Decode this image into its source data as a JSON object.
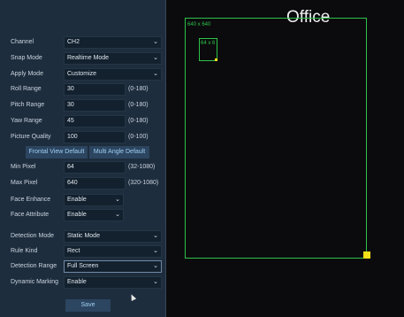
{
  "form": {
    "channel": {
      "label": "Channel",
      "value": "CH2"
    },
    "snap_mode": {
      "label": "Snap Mode",
      "value": "Realtime Mode"
    },
    "apply_mode": {
      "label": "Apply Mode",
      "value": "Customize"
    },
    "roll_range": {
      "label": "Roll Range",
      "value": "30",
      "hint": "(0-180)"
    },
    "pitch_range": {
      "label": "Pitch Range",
      "value": "30",
      "hint": "(0-180)"
    },
    "yaw_range": {
      "label": "Yaw Range",
      "value": "45",
      "hint": "(0-180)"
    },
    "picture_quality": {
      "label": "Picture Quality",
      "value": "100",
      "hint": "(0-100)"
    },
    "frontal_default_label": "Frontal View Default",
    "multi_angle_default_label": "Multi Angle Default",
    "min_pixel": {
      "label": "Min Pixel",
      "value": "64",
      "hint": "(32-1080)"
    },
    "max_pixel": {
      "label": "Max Pixel",
      "value": "640",
      "hint": "(320-1080)"
    },
    "face_enhance": {
      "label": "Face Enhance",
      "value": "Enable"
    },
    "face_attribute": {
      "label": "Face Attribute",
      "value": "Enable"
    },
    "detection_mode": {
      "label": "Detection Mode",
      "value": "Static Mode"
    },
    "rule_kind": {
      "label": "Rule Kind",
      "value": "Rect"
    },
    "detection_range": {
      "label": "Detection Range",
      "value": "Full Screen"
    },
    "dynamic_marking": {
      "label": "Dynamic Marking",
      "value": "Enable"
    },
    "save_label": "Save"
  },
  "preview": {
    "channel_title": "Office",
    "max_box_label": "640 x 640",
    "min_box_label": "64 x 6",
    "box_color": "#2ec24a",
    "handle_color": "#f0e01a"
  },
  "icons": {
    "dropdown": "chevron-down-icon",
    "cursor": "mouse-pointer-icon"
  }
}
